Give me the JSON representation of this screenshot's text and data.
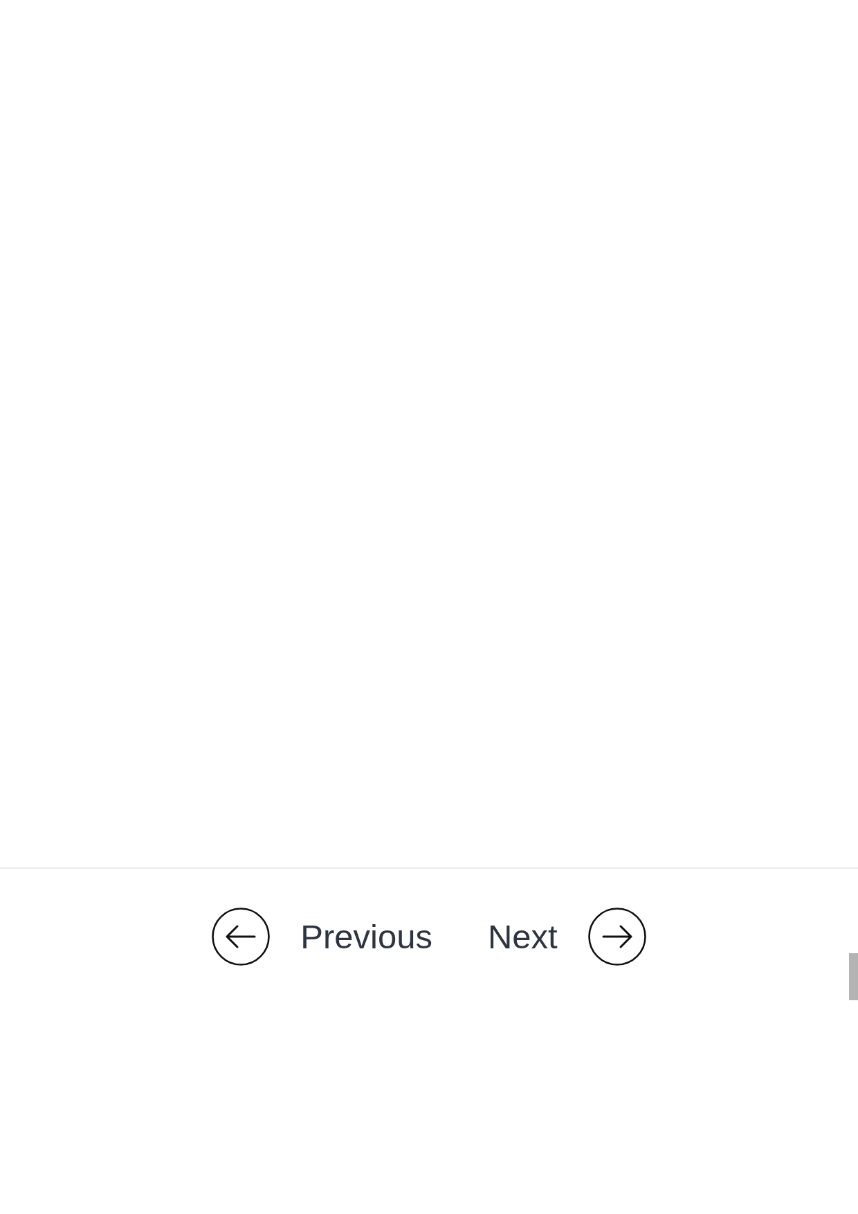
{
  "pagination": {
    "buttons": [
      {
        "kind": "previous",
        "label": "Previous"
      },
      {
        "kind": "next",
        "label": "Next"
      }
    ]
  }
}
